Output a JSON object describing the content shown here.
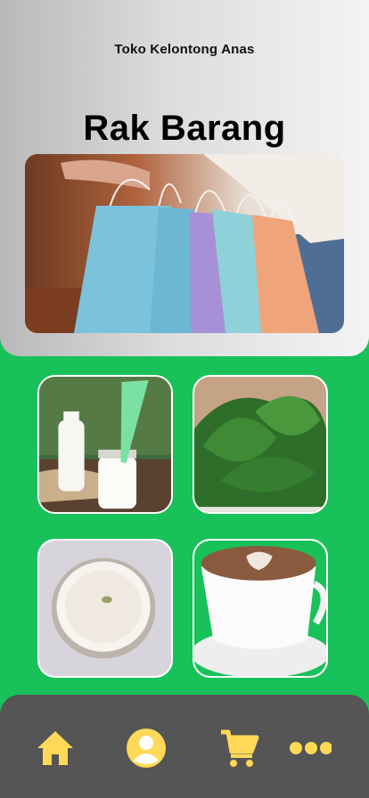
{
  "header": {
    "store_name": "Toko Kelontong Anas",
    "title": "Rak Barang"
  },
  "products": [
    {
      "name": "milk-product-tile"
    },
    {
      "name": "spinach-product-tile"
    },
    {
      "name": "rice-product-tile"
    },
    {
      "name": "coffee-product-tile"
    }
  ],
  "nav": {
    "icons": [
      "home-icon",
      "profile-icon",
      "cart-icon",
      "more-icon"
    ]
  },
  "colors": {
    "background": "#19c15a",
    "nav": "#555555",
    "accent": "#ffd957"
  }
}
